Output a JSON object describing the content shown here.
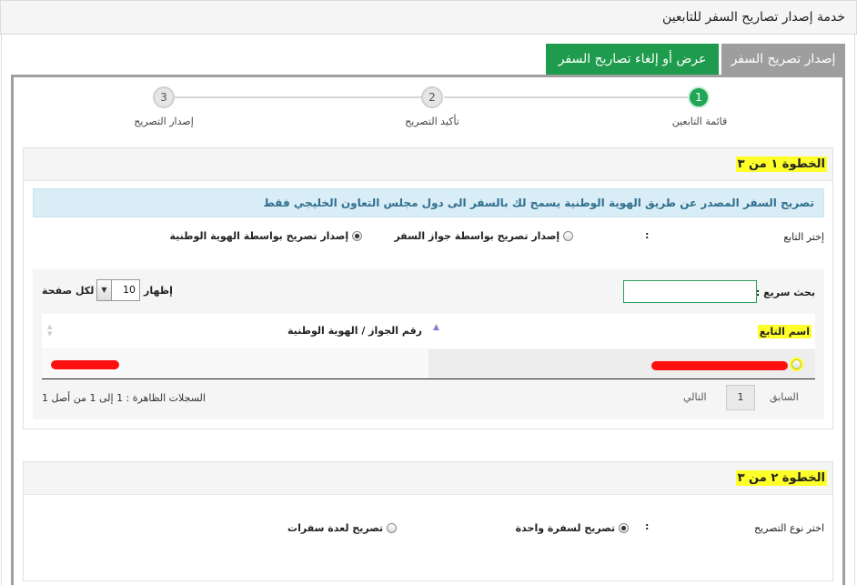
{
  "page_title": "خدمة إصدار تصاريح السفر للتابعين",
  "tabs": {
    "issue": "إصدار تصريح السفر",
    "view_cancel": "عرض أو إلغاء تصاريح السفر"
  },
  "stepper": {
    "step1": {
      "number": "1",
      "label": "قائمة التابعين"
    },
    "step2": {
      "number": "2",
      "label": "تأكيد التصريح"
    },
    "step3": {
      "number": "3",
      "label": "إصدار التصريح"
    }
  },
  "section1": {
    "heading": "الخطوة ١ من ٣",
    "alert": "تصريح السفر المصدر عن طريق الهوية الوطنية يسمح لك بالسفر الى دول مجلس التعاون الخليجي فقط",
    "choose_dependent_label": "إختر التابع",
    "colon": ":",
    "option_passport": "إصدار تصريح بواسطة جواز السفر",
    "option_national_id": "إصدار تصريح بواسطة الهوية الوطنية",
    "selected_option": "national_id",
    "table": {
      "search_label": "بحث سريع :",
      "search_value": "",
      "show_label": "إظهار",
      "page_length": "10",
      "per_page_label": "لكل صفحة",
      "columns": {
        "name": "اسم التابع",
        "id_number": "رقم الجواز / الهوية الوطنية"
      },
      "pagination": {
        "previous": "السابق",
        "current_page": "1",
        "next": "التالي"
      },
      "records_info": "السجلات الظاهرة : 1 إلى 1 من أصل 1"
    }
  },
  "section2": {
    "heading": "الخطوة ٢ من ٣",
    "permit_type_label": "اختر نوع التصريح",
    "colon": ":",
    "option_single": "تصريح لسفرة واحدة",
    "option_multiple": "تصريح لعدة سفرات",
    "selected_option": "single"
  },
  "colors": {
    "primary_green": "#1e9b4c",
    "step_active": "#20a655",
    "tab_inactive": "#9e9e9e",
    "highlight_yellow": "#ffff2a",
    "redaction_red": "#ff1010",
    "alert_bg": "#d9edf7",
    "alert_text": "#31708f"
  },
  "icons": {
    "page_length_toggle": "chevron-down-icon",
    "sort_asc": "sort-up-icon",
    "sort_both": "sort-both-icon"
  }
}
